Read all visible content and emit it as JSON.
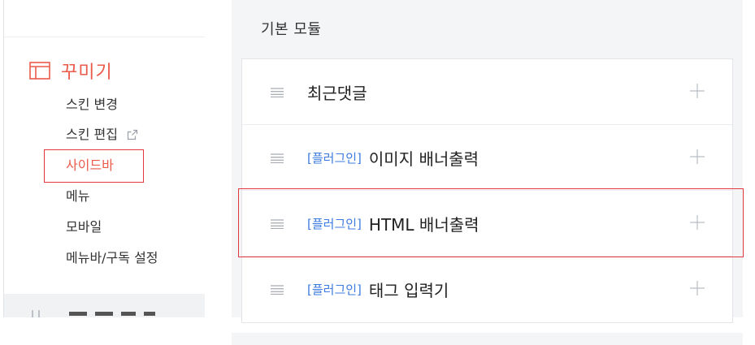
{
  "sidebar": {
    "section_title": "꾸미기",
    "section_icon": "layout-icon",
    "items": [
      {
        "label": "스킨 변경"
      },
      {
        "label": "스킨 편집",
        "icon": "external-link-icon"
      },
      {
        "label": "사이드바",
        "active": true
      },
      {
        "label": "메뉴"
      },
      {
        "label": "모바일"
      },
      {
        "label": "메뉴바/구독 설정"
      }
    ]
  },
  "panel": {
    "title": "기본 모듈",
    "modules": [
      {
        "tag": "",
        "name": "최근댓글"
      },
      {
        "tag": "[플러그인]",
        "name": "이미지 배너출력"
      },
      {
        "tag": "[플러그인]",
        "name": "HTML 배너출력",
        "highlighted": true
      },
      {
        "tag": "[플러그인]",
        "name": "태그 입력기"
      }
    ]
  },
  "colors": {
    "accent": "#eb5a4a",
    "highlight_border": "#e2383f",
    "plugin_tag": "#3c7be0",
    "panel_bg": "#f4f5f7"
  }
}
